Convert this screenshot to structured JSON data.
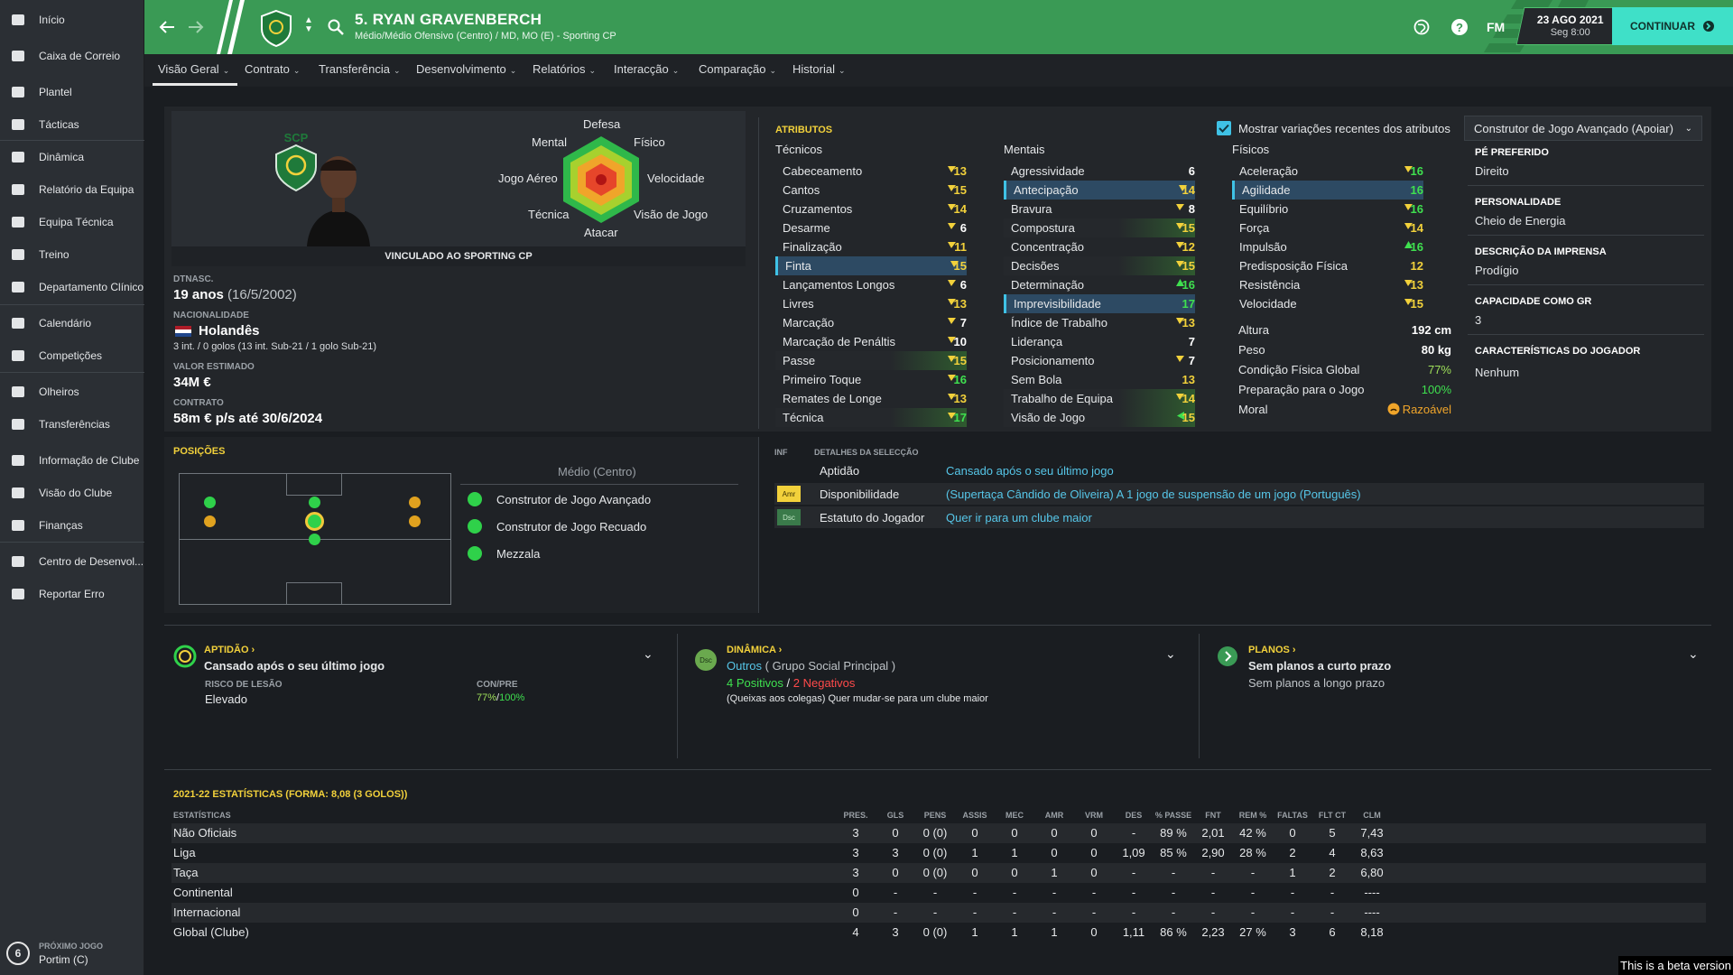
{
  "sidebar": {
    "items": [
      {
        "label": "Início",
        "icon": "home-icon"
      },
      {
        "label": "Caixa de Correio",
        "icon": "inbox-icon"
      },
      {
        "label": "Plantel",
        "icon": "squad-icon"
      },
      {
        "label": "Tácticas",
        "icon": "tactics-icon"
      },
      {
        "label": "Dinâmica",
        "icon": "dynamics-icon"
      },
      {
        "label": "Relatório da Equipa",
        "icon": "report-icon"
      },
      {
        "label": "Equipa Técnica",
        "icon": "staff-icon"
      },
      {
        "label": "Treino",
        "icon": "training-icon"
      },
      {
        "label": "Departamento Clínico",
        "icon": "medical-icon"
      },
      {
        "label": "Calendário",
        "icon": "calendar-icon"
      },
      {
        "label": "Competições",
        "icon": "trophy-icon"
      },
      {
        "label": "Olheiros",
        "icon": "scouting-icon"
      },
      {
        "label": "Transferências",
        "icon": "transfers-icon"
      },
      {
        "label": "Informação de Clube",
        "icon": "club-info-icon"
      },
      {
        "label": "Visão do Clube",
        "icon": "club-vision-icon"
      },
      {
        "label": "Finanças",
        "icon": "finances-icon"
      },
      {
        "label": "Centro de Desenvol...",
        "icon": "development-icon"
      },
      {
        "label": "Reportar Erro",
        "icon": "bug-icon"
      }
    ],
    "next_match_label": "PRÓXIMO JOGO",
    "next_match": "Portim (C)",
    "next_match_badge": "6"
  },
  "header": {
    "player_name": "5. RYAN GRAVENBERCH",
    "player_sub": "Médio/Médio Ofensivo (Centro) / MD, MO (E) - Sporting CP",
    "fm": "FM",
    "date": "23 AGO 2021",
    "time": "Seg 8:00",
    "continue": "CONTINUAR"
  },
  "tabs": [
    "Visão Geral",
    "Contrato",
    "Transferência",
    "Desenvolvimento",
    "Relatórios",
    "Interacção",
    "Comparação",
    "Historial"
  ],
  "profile": {
    "club_crest_text": "SCP",
    "radar": {
      "top": "Defesa",
      "tl": "Mental",
      "tr": "Físico",
      "l": "Jogo Aéreo",
      "r": "Velocidade",
      "bl": "Técnica",
      "br": "Visão de Jogo",
      "bottom": "Atacar"
    },
    "contract_banner": "VINCULADO AO SPORTING CP",
    "dob_label": "DTNASC.",
    "age": "19 anos",
    "dob": "(16/5/2002)",
    "nat_label": "NACIONALIDADE",
    "nationality": "Holandês",
    "caps": "3 int. / 0 golos (13 int. Sub-21 / 1 golo Sub-21)",
    "value_label": "VALOR ESTIMADO",
    "value": "34M €",
    "contract_label": "CONTRATO",
    "contract": "58m € p/s até 30/6/2024"
  },
  "attributes": {
    "title": "ATRIBUTOS",
    "show_changes": "Mostrar variações recentes dos atributos",
    "technical_title": "Técnicos",
    "mental_title": "Mentais",
    "physical_title": "Físicos",
    "technical": [
      {
        "n": "Cabeceamento",
        "v": "13",
        "t": "dn"
      },
      {
        "n": "Cantos",
        "v": "15",
        "t": "dn"
      },
      {
        "n": "Cruzamentos",
        "v": "14",
        "t": "dn"
      },
      {
        "n": "Desarme",
        "v": "6",
        "t": "dn"
      },
      {
        "n": "Finalização",
        "v": "11",
        "t": "dn"
      },
      {
        "n": "Finta",
        "v": "15",
        "t": "dn",
        "hl": "blue"
      },
      {
        "n": "Lançamentos Longos",
        "v": "6",
        "t": "dn"
      },
      {
        "n": "Livres",
        "v": "13",
        "t": "dn"
      },
      {
        "n": "Marcação",
        "v": "7",
        "t": "dn"
      },
      {
        "n": "Marcação de Penáltis",
        "v": "10",
        "t": "dn"
      },
      {
        "n": "Passe",
        "v": "15",
        "t": "dn",
        "hl": "green"
      },
      {
        "n": "Primeiro Toque",
        "v": "16",
        "t": "dn"
      },
      {
        "n": "Remates de Longe",
        "v": "13",
        "t": "dn"
      },
      {
        "n": "Técnica",
        "v": "17",
        "t": "dn",
        "hl": "green"
      }
    ],
    "mental": [
      {
        "n": "Agressividade",
        "v": "6",
        "t": ""
      },
      {
        "n": "Antecipação",
        "v": "14",
        "t": "dn",
        "hl": "blue"
      },
      {
        "n": "Bravura",
        "v": "8",
        "t": "dn"
      },
      {
        "n": "Compostura",
        "v": "15",
        "t": "dn",
        "hl": "green"
      },
      {
        "n": "Concentração",
        "v": "12",
        "t": "dn"
      },
      {
        "n": "Decisões",
        "v": "15",
        "t": "dn",
        "hl": "green"
      },
      {
        "n": "Determinação",
        "v": "16",
        "t": "up"
      },
      {
        "n": "Imprevisibilidade",
        "v": "17",
        "t": "",
        "hl": "blue"
      },
      {
        "n": "Índice de Trabalho",
        "v": "13",
        "t": "dn"
      },
      {
        "n": "Liderança",
        "v": "7",
        "t": ""
      },
      {
        "n": "Posicionamento",
        "v": "7",
        "t": "dn"
      },
      {
        "n": "Sem Bola",
        "v": "13",
        "t": ""
      },
      {
        "n": "Trabalho de Equipa",
        "v": "14",
        "t": "dn",
        "hl": "green"
      },
      {
        "n": "Visão de Jogo",
        "v": "15",
        "t": "lf",
        "hl": "green"
      }
    ],
    "physical": [
      {
        "n": "Aceleração",
        "v": "16",
        "t": "dn"
      },
      {
        "n": "Agilidade",
        "v": "16",
        "t": "",
        "hl": "blue"
      },
      {
        "n": "Equilíbrio",
        "v": "16",
        "t": "dn"
      },
      {
        "n": "Força",
        "v": "14",
        "t": "dn"
      },
      {
        "n": "Impulsão",
        "v": "16",
        "t": "up"
      },
      {
        "n": "Predisposição Física",
        "v": "12",
        "t": ""
      },
      {
        "n": "Resistência",
        "v": "13",
        "t": "dn"
      },
      {
        "n": "Velocidade",
        "v": "15",
        "t": "dn"
      }
    ],
    "extra": [
      {
        "n": "Altura",
        "v": "192 cm"
      },
      {
        "n": "Peso",
        "v": "80 kg"
      },
      {
        "n": "Condição Física Global",
        "v": "77%"
      },
      {
        "n": "Preparação para o Jogo",
        "v": "100%"
      },
      {
        "n": "Moral",
        "v": "Razoável"
      }
    ]
  },
  "role": {
    "select": "Construtor de Jogo Avançado (Apoiar)",
    "foot_label": "PÉ PREFERIDO",
    "foot": "Direito",
    "personality_label": "PERSONALIDADE",
    "personality": "Cheio de Energia",
    "media_label": "DESCRIÇÃO DA IMPRENSA",
    "media": "Prodígio",
    "gk_label": "CAPACIDADE COMO GR",
    "gk": "3",
    "traits_label": "CARACTERÍSTICAS DO JOGADOR",
    "traits": "Nenhum"
  },
  "positions": {
    "title": "POSIÇÕES",
    "subtitle": "Médio (Centro)",
    "roles": [
      "Construtor de Jogo Avançado",
      "Construtor de Jogo Recuado",
      "Mezzala"
    ]
  },
  "selection": {
    "col1": "INF",
    "col2": "DETALHES DA SELECÇÃO",
    "rows": [
      {
        "tag": "",
        "k": "Aptidão",
        "v": "Cansado após o seu último jogo"
      },
      {
        "tag": "Amr",
        "k": "Disponibilidade",
        "v": "(Supertaça Cândido de Oliveira) A 1 jogo de suspensão de um jogo (Português)"
      },
      {
        "tag": "Dsc",
        "k": "Estatuto do Jogador",
        "v": "Quer ir para um clube maior"
      }
    ]
  },
  "cards": {
    "fitness": {
      "title": "APTIDÃO",
      "text": "Cansado após o seu último jogo",
      "risk_label": "RISCO DE LESÃO",
      "risk": "Elevado",
      "conpre_label": "CON/PRE",
      "con": "77%",
      "pre": "100%"
    },
    "dynamics": {
      "title": "DINÂMICA",
      "badge": "Dsc",
      "group": "Outros",
      "group_sub": "( Grupo Social Principal )",
      "pos": "4 Positivos",
      "sep": "/",
      "neg": "2 Negativos",
      "note": "(Queixas aos colegas) Quer mudar-se para um clube maior"
    },
    "plans": {
      "title": "PLANOS",
      "short": "Sem planos a curto prazo",
      "long": "Sem planos a longo prazo"
    }
  },
  "stats": {
    "title": "2021-22 ESTATÍSTICAS (FORMA: 8,08 (3 GOLOS))",
    "headers": [
      "ESTATÍSTICAS",
      "PRES.",
      "GLS",
      "PENS",
      "ASSIS",
      "MEC",
      "AMR",
      "VRM",
      "DES",
      "% PASSE",
      "FNT",
      "REM %",
      "FALTAS",
      "FLT CT",
      "CLM"
    ],
    "rows": [
      [
        "Não Oficiais",
        "3",
        "0",
        "0 (0)",
        "0",
        "0",
        "0",
        "0",
        "-",
        "89 %",
        "2,01",
        "42 %",
        "0",
        "5",
        "7,43"
      ],
      [
        "Liga",
        "3",
        "3",
        "0 (0)",
        "1",
        "1",
        "0",
        "0",
        "1,09",
        "85 %",
        "2,90",
        "28 %",
        "2",
        "4",
        "8,63"
      ],
      [
        "Taça",
        "3",
        "0",
        "0 (0)",
        "0",
        "0",
        "1",
        "0",
        "-",
        "-",
        "-",
        "-",
        "1",
        "2",
        "6,80"
      ],
      [
        "Continental",
        "0",
        "-",
        "-",
        "-",
        "-",
        "-",
        "-",
        "-",
        "-",
        "-",
        "-",
        "-",
        "-",
        "----"
      ],
      [
        "Internacional",
        "0",
        "-",
        "-",
        "-",
        "-",
        "-",
        "-",
        "-",
        "-",
        "-",
        "-",
        "-",
        "-",
        "----"
      ],
      [
        "Global (Clube)",
        "4",
        "3",
        "0 (0)",
        "1",
        "1",
        "1",
        "0",
        "1,11",
        "86 %",
        "2,23",
        "27 %",
        "3",
        "6",
        "8,18"
      ]
    ]
  },
  "beta": "This is a beta version",
  "colors": {
    "header": "#3a9a55",
    "accent": "#3fe0c8",
    "yellow": "#f2d13b",
    "green_val": "#3fe04f"
  }
}
